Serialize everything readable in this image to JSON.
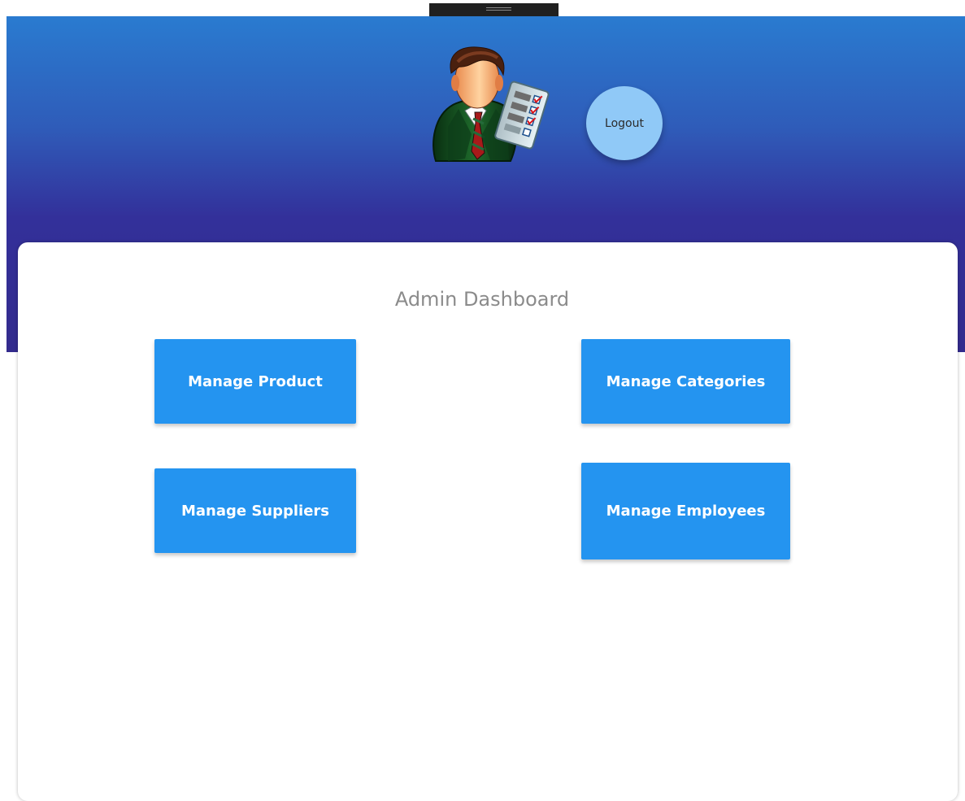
{
  "header": {
    "avatar_icon": "admin-user-checklist-icon",
    "logout_label": "Logout"
  },
  "dashboard": {
    "title": "Admin Dashboard",
    "actions": {
      "manage_product": "Manage Product",
      "manage_categories": "Manage Categories",
      "manage_suppliers": "Manage Suppliers",
      "manage_employees": "Manage Employees"
    }
  },
  "colors": {
    "header_top": "#2a7bd0",
    "header_bottom": "#332b8d",
    "logout_button": "#90c9f7",
    "action_button": "#2494f0",
    "card_background": "#ffffff",
    "title_text": "#8b8b8b"
  }
}
